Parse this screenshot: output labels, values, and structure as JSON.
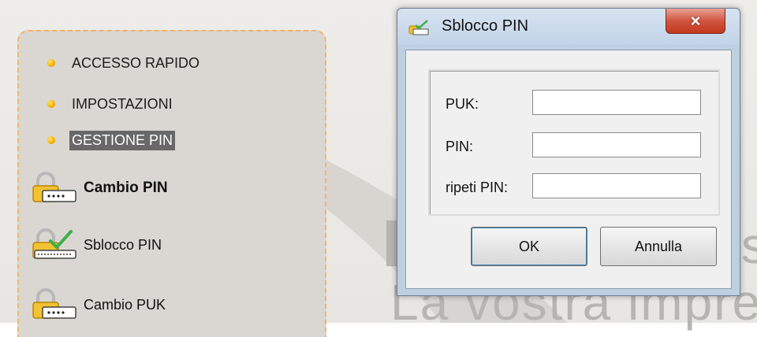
{
  "sidebar": {
    "menu": [
      {
        "label": "ACCESSO RAPIDO"
      },
      {
        "label": "IMPOSTAZIONI"
      },
      {
        "label": "GESTIONE PIN"
      }
    ],
    "actions": [
      {
        "label": "Cambio PIN",
        "icon": "padlock-key-icon"
      },
      {
        "label": "Sblocco PIN",
        "icon": "padlock-check-icon"
      },
      {
        "label": "Cambio PUK",
        "icon": "padlock-key-icon"
      }
    ]
  },
  "background": {
    "watermark_text": "La vostra impre",
    "watermark_fragment": "s"
  },
  "dialog": {
    "title": "Sblocco PIN",
    "close_icon": "×",
    "fields": [
      {
        "label": "PUK:",
        "value": ""
      },
      {
        "label": "PIN:",
        "value": ""
      },
      {
        "label": "ripeti PIN:",
        "value": ""
      }
    ],
    "ok_label": "OK",
    "cancel_label": "Annulla"
  },
  "colors": {
    "selected_bg": "#686868",
    "bullet": "#f5b400",
    "panel_border": "#f2b469",
    "close_button": "#c1391f"
  }
}
